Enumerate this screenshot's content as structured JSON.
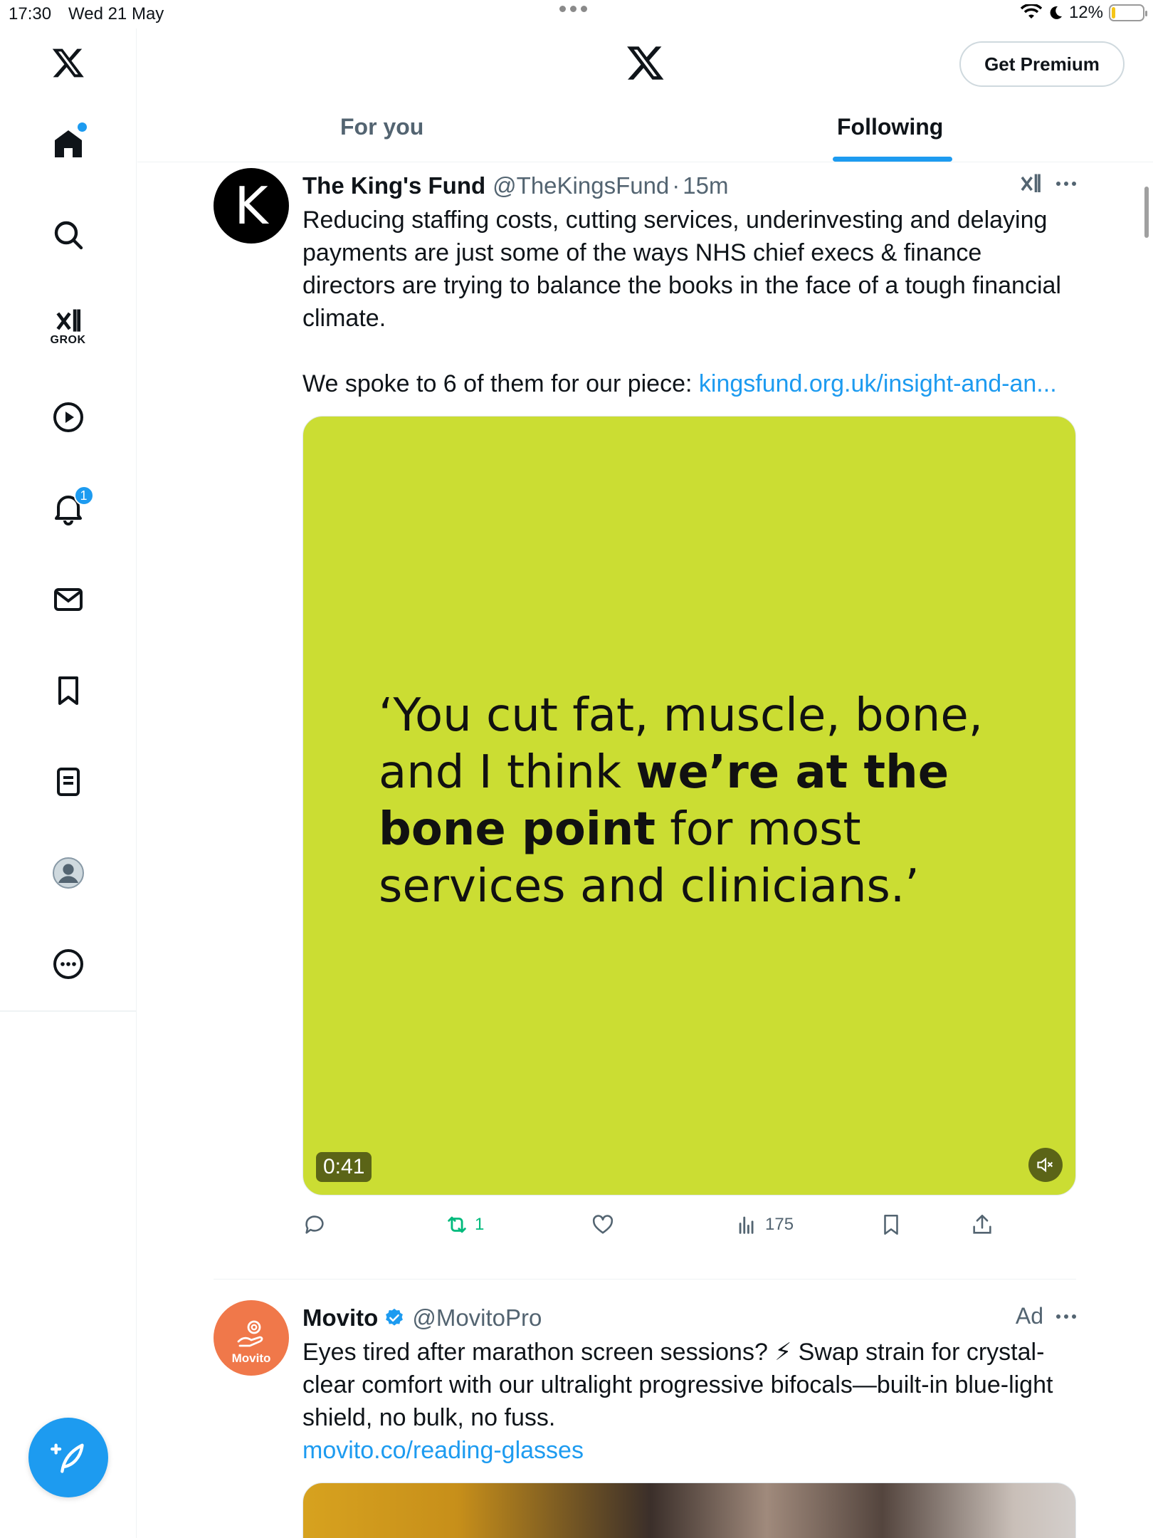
{
  "status_bar": {
    "time": "17:30",
    "date": "Wed 21 May",
    "battery": "12%",
    "battery_level": 0.12
  },
  "nav": {
    "items": [
      "home",
      "search",
      "grok",
      "video",
      "notifications",
      "messages",
      "bookmarks",
      "lists",
      "profile",
      "more"
    ],
    "grok_label": "GROK",
    "notification_count": "1"
  },
  "header": {
    "premium_label": "Get Premium",
    "tabs": [
      {
        "label": "For you",
        "active": false
      },
      {
        "label": "Following",
        "active": true
      }
    ]
  },
  "tweets": [
    {
      "name": "The King's Fund",
      "handle": "@TheKingsFund",
      "separator": "·",
      "time": "15m",
      "avatar_letter": "K",
      "text_main": "Reducing staffing costs, cutting services, underinvesting and delaying payments are just some of the ways NHS chief execs & finance directors are trying to balance the books in the face of a tough financial climate.",
      "text_second": "We spoke to 6 of them for our piece:",
      "link": "kingsfund.org.uk/insight-and-an...",
      "media": {
        "quote_part1": "‘You cut fat, muscle, bone, and I think ",
        "quote_bold": "we’re at the bone point",
        "quote_part2": " for most services and clinicians.’",
        "duration": "0:41",
        "background": "#cbdd33"
      },
      "actions": {
        "retweets": "1",
        "views": "175"
      }
    },
    {
      "name": "Movito",
      "handle": "@MovitoPro",
      "ad_label": "Ad",
      "avatar_text": "Movito",
      "text": "Eyes tired after marathon screen sessions? ⚡ Swap strain for crystal-clear comfort with our ultralight progressive bifocals—built-in blue-light shield, no bulk, no fuss.",
      "link": "movito.co/reading-glasses"
    }
  ],
  "colors": {
    "accent": "#1d9bf0",
    "retweet_green": "#00ba7c",
    "text_secondary": "#536471"
  }
}
